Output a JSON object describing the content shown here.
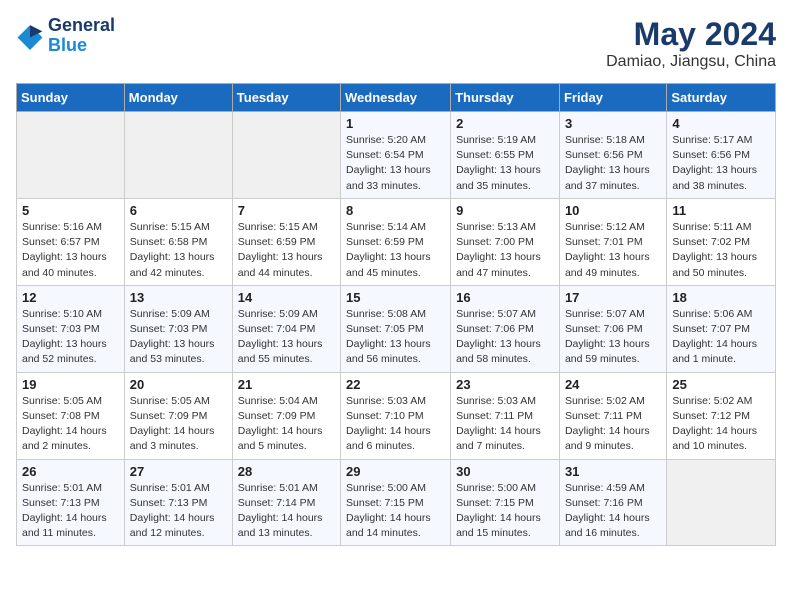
{
  "header": {
    "logo_line1": "General",
    "logo_line2": "Blue",
    "title": "May 2024",
    "subtitle": "Damiao, Jiangsu, China"
  },
  "weekdays": [
    "Sunday",
    "Monday",
    "Tuesday",
    "Wednesday",
    "Thursday",
    "Friday",
    "Saturday"
  ],
  "weeks": [
    [
      {
        "day": "",
        "info": ""
      },
      {
        "day": "",
        "info": ""
      },
      {
        "day": "",
        "info": ""
      },
      {
        "day": "1",
        "info": "Sunrise: 5:20 AM\nSunset: 6:54 PM\nDaylight: 13 hours\nand 33 minutes."
      },
      {
        "day": "2",
        "info": "Sunrise: 5:19 AM\nSunset: 6:55 PM\nDaylight: 13 hours\nand 35 minutes."
      },
      {
        "day": "3",
        "info": "Sunrise: 5:18 AM\nSunset: 6:56 PM\nDaylight: 13 hours\nand 37 minutes."
      },
      {
        "day": "4",
        "info": "Sunrise: 5:17 AM\nSunset: 6:56 PM\nDaylight: 13 hours\nand 38 minutes."
      }
    ],
    [
      {
        "day": "5",
        "info": "Sunrise: 5:16 AM\nSunset: 6:57 PM\nDaylight: 13 hours\nand 40 minutes."
      },
      {
        "day": "6",
        "info": "Sunrise: 5:15 AM\nSunset: 6:58 PM\nDaylight: 13 hours\nand 42 minutes."
      },
      {
        "day": "7",
        "info": "Sunrise: 5:15 AM\nSunset: 6:59 PM\nDaylight: 13 hours\nand 44 minutes."
      },
      {
        "day": "8",
        "info": "Sunrise: 5:14 AM\nSunset: 6:59 PM\nDaylight: 13 hours\nand 45 minutes."
      },
      {
        "day": "9",
        "info": "Sunrise: 5:13 AM\nSunset: 7:00 PM\nDaylight: 13 hours\nand 47 minutes."
      },
      {
        "day": "10",
        "info": "Sunrise: 5:12 AM\nSunset: 7:01 PM\nDaylight: 13 hours\nand 49 minutes."
      },
      {
        "day": "11",
        "info": "Sunrise: 5:11 AM\nSunset: 7:02 PM\nDaylight: 13 hours\nand 50 minutes."
      }
    ],
    [
      {
        "day": "12",
        "info": "Sunrise: 5:10 AM\nSunset: 7:03 PM\nDaylight: 13 hours\nand 52 minutes."
      },
      {
        "day": "13",
        "info": "Sunrise: 5:09 AM\nSunset: 7:03 PM\nDaylight: 13 hours\nand 53 minutes."
      },
      {
        "day": "14",
        "info": "Sunrise: 5:09 AM\nSunset: 7:04 PM\nDaylight: 13 hours\nand 55 minutes."
      },
      {
        "day": "15",
        "info": "Sunrise: 5:08 AM\nSunset: 7:05 PM\nDaylight: 13 hours\nand 56 minutes."
      },
      {
        "day": "16",
        "info": "Sunrise: 5:07 AM\nSunset: 7:06 PM\nDaylight: 13 hours\nand 58 minutes."
      },
      {
        "day": "17",
        "info": "Sunrise: 5:07 AM\nSunset: 7:06 PM\nDaylight: 13 hours\nand 59 minutes."
      },
      {
        "day": "18",
        "info": "Sunrise: 5:06 AM\nSunset: 7:07 PM\nDaylight: 14 hours\nand 1 minute."
      }
    ],
    [
      {
        "day": "19",
        "info": "Sunrise: 5:05 AM\nSunset: 7:08 PM\nDaylight: 14 hours\nand 2 minutes."
      },
      {
        "day": "20",
        "info": "Sunrise: 5:05 AM\nSunset: 7:09 PM\nDaylight: 14 hours\nand 3 minutes."
      },
      {
        "day": "21",
        "info": "Sunrise: 5:04 AM\nSunset: 7:09 PM\nDaylight: 14 hours\nand 5 minutes."
      },
      {
        "day": "22",
        "info": "Sunrise: 5:03 AM\nSunset: 7:10 PM\nDaylight: 14 hours\nand 6 minutes."
      },
      {
        "day": "23",
        "info": "Sunrise: 5:03 AM\nSunset: 7:11 PM\nDaylight: 14 hours\nand 7 minutes."
      },
      {
        "day": "24",
        "info": "Sunrise: 5:02 AM\nSunset: 7:11 PM\nDaylight: 14 hours\nand 9 minutes."
      },
      {
        "day": "25",
        "info": "Sunrise: 5:02 AM\nSunset: 7:12 PM\nDaylight: 14 hours\nand 10 minutes."
      }
    ],
    [
      {
        "day": "26",
        "info": "Sunrise: 5:01 AM\nSunset: 7:13 PM\nDaylight: 14 hours\nand 11 minutes."
      },
      {
        "day": "27",
        "info": "Sunrise: 5:01 AM\nSunset: 7:13 PM\nDaylight: 14 hours\nand 12 minutes."
      },
      {
        "day": "28",
        "info": "Sunrise: 5:01 AM\nSunset: 7:14 PM\nDaylight: 14 hours\nand 13 minutes."
      },
      {
        "day": "29",
        "info": "Sunrise: 5:00 AM\nSunset: 7:15 PM\nDaylight: 14 hours\nand 14 minutes."
      },
      {
        "day": "30",
        "info": "Sunrise: 5:00 AM\nSunset: 7:15 PM\nDaylight: 14 hours\nand 15 minutes."
      },
      {
        "day": "31",
        "info": "Sunrise: 4:59 AM\nSunset: 7:16 PM\nDaylight: 14 hours\nand 16 minutes."
      },
      {
        "day": "",
        "info": ""
      }
    ]
  ]
}
